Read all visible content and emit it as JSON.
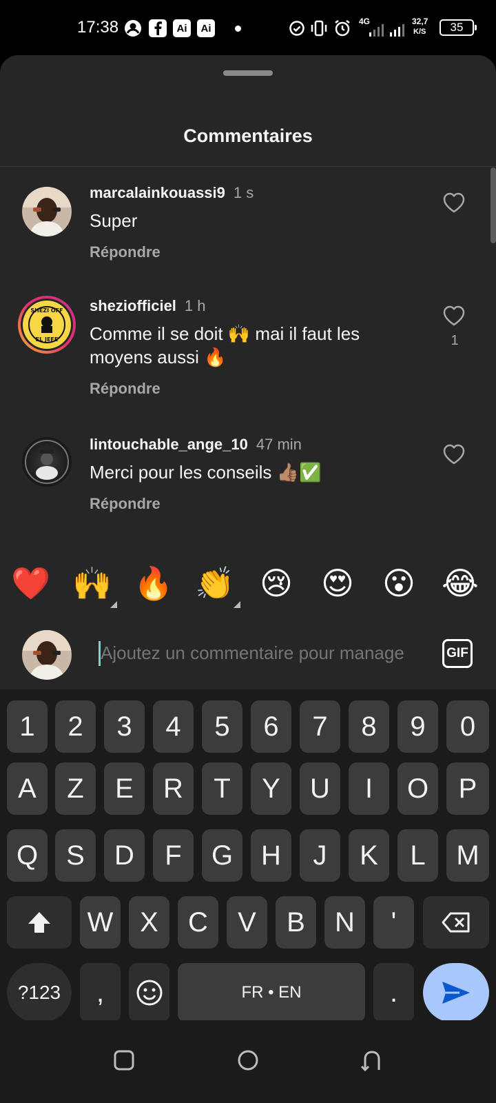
{
  "status_bar": {
    "time": "17:38",
    "icons": [
      "account-icon",
      "facebook-icon",
      "ai-icon",
      "ai-icon",
      "notification-dot-icon",
      "data-saver-icon",
      "vibrate-icon",
      "alarm-icon",
      "signal-4g-icon",
      "signal-icon"
    ],
    "network_type": "4G",
    "speed_value": "32,7",
    "speed_unit": "K/S",
    "battery": "35",
    "ai_label": "Ai"
  },
  "sheet": {
    "title": "Commentaires"
  },
  "comments": [
    {
      "username": "marcalainkouassi9",
      "time": "1 s",
      "text": "Super",
      "reply_label": "Répondre",
      "likes": ""
    },
    {
      "username": "sheziofficiel",
      "time": "1 h",
      "text": "Comme il se doit 🙌 mai il faut les moyens aussi 🔥",
      "reply_label": "Répondre",
      "likes": "1",
      "avatar_text": "SHEZI OFF EL JEFE"
    },
    {
      "username": "lintouchable_ange_10",
      "time": "47 min",
      "text": "Merci pour les conseils 👍🏽✅",
      "reply_label": "Répondre",
      "likes": ""
    }
  ],
  "emoji_bar": [
    "❤️",
    "🙌",
    "🔥",
    "👏",
    "😢",
    "😍",
    "😮",
    "😂"
  ],
  "composer": {
    "placeholder": "Ajoutez un commentaire pour manage",
    "gif_label": "GIF"
  },
  "keyboard": {
    "row1": [
      "1",
      "2",
      "3",
      "4",
      "5",
      "6",
      "7",
      "8",
      "9",
      "0"
    ],
    "row2": [
      "A",
      "Z",
      "E",
      "R",
      "T",
      "Y",
      "U",
      "I",
      "O",
      "P"
    ],
    "row3": [
      "Q",
      "S",
      "D",
      "F",
      "G",
      "H",
      "J",
      "K",
      "L",
      "M"
    ],
    "row4": [
      "W",
      "X",
      "C",
      "V",
      "B",
      "N",
      "'"
    ],
    "symbols_label": "?123",
    "comma_label": ",",
    "space_label": "FR • EN",
    "period_label": "."
  },
  "colors": {
    "sheet_bg": "#262626",
    "keyboard_bg": "#1b1b1b",
    "send_button": "#a8c7fa",
    "send_icon": "#0b57d0"
  }
}
